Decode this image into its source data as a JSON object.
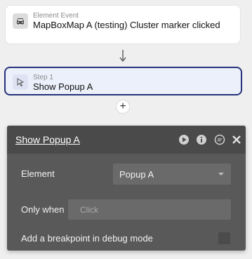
{
  "event": {
    "type_label": "Element Event",
    "title": "MapBoxMap A (testing) Cluster marker clicked",
    "icon": "car-icon"
  },
  "step": {
    "number_label": "Step 1",
    "title": "Show Popup A",
    "icon": "cursor-icon"
  },
  "add_step_label": "+",
  "panel": {
    "title": "Show Popup A",
    "icons": [
      "play-icon",
      "info-icon",
      "comment-icon",
      "close-icon"
    ],
    "element_label": "Element",
    "element_value": "Popup A",
    "only_when_label": "Only when",
    "only_when_placeholder": "Click",
    "breakpoint_label": "Add a breakpoint in debug mode"
  },
  "colors": {
    "accent": "#26337a",
    "panel_bg": "#595959",
    "panel_header": "#4a4a4a"
  }
}
